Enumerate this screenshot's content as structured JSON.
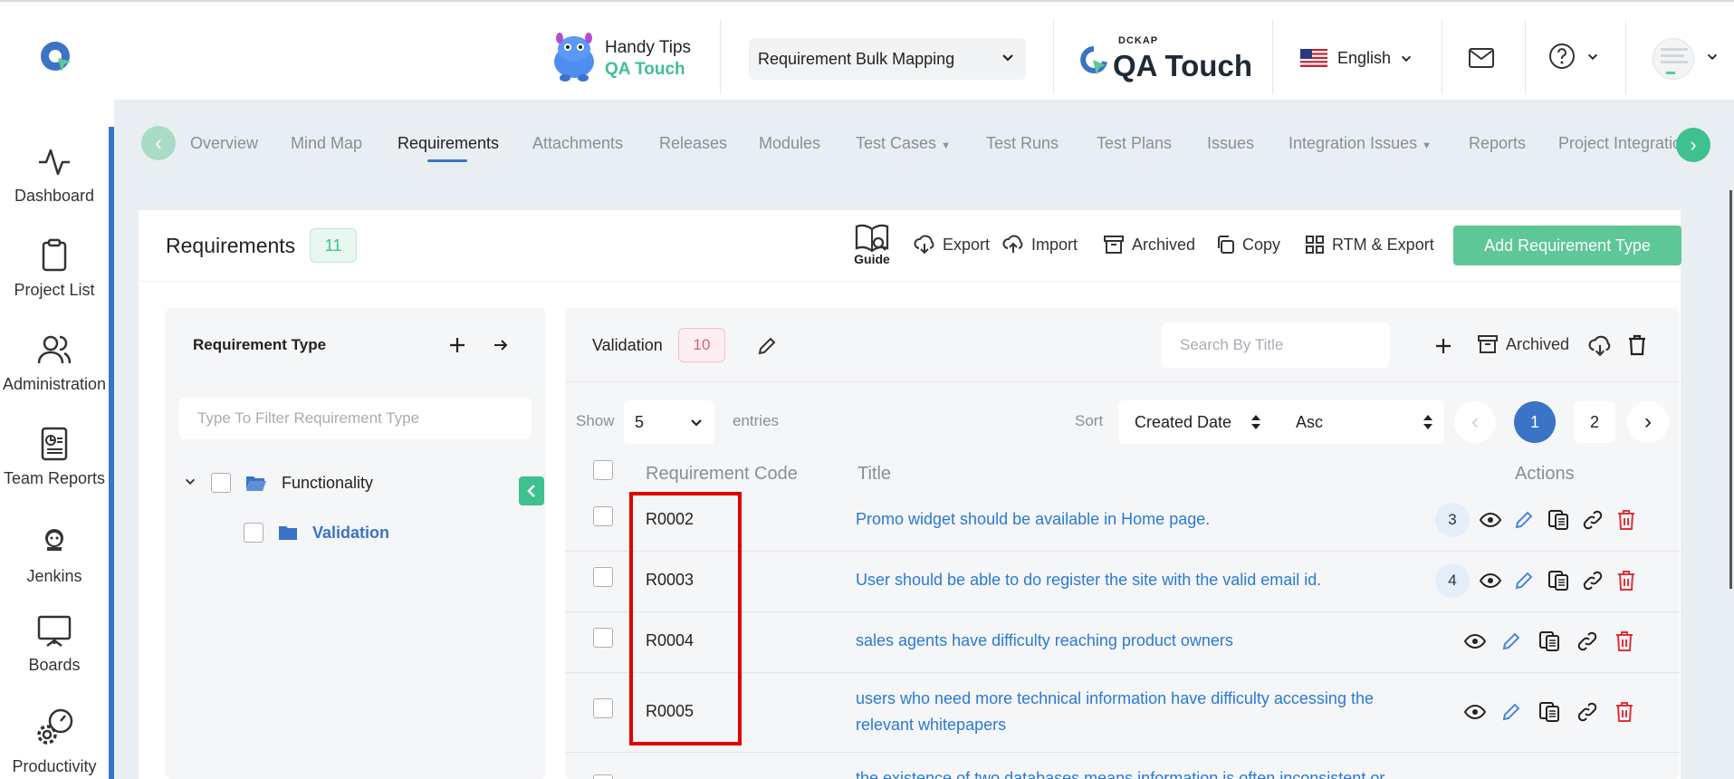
{
  "header": {
    "handy_tips_title": "Handy Tips",
    "handy_tips_subtitle": "QA Touch",
    "project_select": "Requirement Bulk Mapping",
    "brand_small": "DCKAP",
    "brand_name": "QA Touch",
    "language": "English"
  },
  "sidebar": {
    "items": [
      {
        "label": "Dashboard",
        "icon": "activity-icon"
      },
      {
        "label": "Project List",
        "icon": "clipboard-icon"
      },
      {
        "label": "Administration",
        "icon": "users-icon"
      },
      {
        "label": "Team Reports",
        "icon": "report-icon"
      },
      {
        "label": "Jenkins",
        "icon": "jenkins-icon"
      },
      {
        "label": "Boards",
        "icon": "board-icon"
      },
      {
        "label": "Productivity",
        "icon": "gear-gauge-icon"
      }
    ]
  },
  "tabs": [
    {
      "label": "Overview"
    },
    {
      "label": "Mind Map"
    },
    {
      "label": "Requirements"
    },
    {
      "label": "Attachments"
    },
    {
      "label": "Releases"
    },
    {
      "label": "Modules"
    },
    {
      "label": "Test Cases"
    },
    {
      "label": "Test Runs"
    },
    {
      "label": "Test Plans"
    },
    {
      "label": "Issues"
    },
    {
      "label": "Integration Issues"
    },
    {
      "label": "Reports"
    },
    {
      "label": "Project Integratio"
    }
  ],
  "page": {
    "title": "Requirements",
    "count": "11",
    "guide": "Guide",
    "export": "Export",
    "import": "Import",
    "archived": "Archived",
    "copy": "Copy",
    "rtm_export": "RTM & Export",
    "add_button": "Add Requirement Type"
  },
  "left_panel": {
    "title": "Requirement Type",
    "filter_placeholder": "Type To Filter Requirement Type",
    "tree": [
      {
        "label": "Functionality"
      },
      {
        "label": "Validation"
      }
    ]
  },
  "right_panel": {
    "title": "Validation",
    "count": "10",
    "search_placeholder": "Search By Title",
    "archived": "Archived",
    "show_label": "Show",
    "show_value": "5",
    "entries_label": "entries",
    "sort_label": "Sort",
    "sort_field": "Created Date",
    "sort_order": "Asc",
    "pagination": [
      "1",
      "2"
    ],
    "columns": {
      "code": "Requirement Code",
      "title": "Title",
      "actions": "Actions"
    },
    "rows": [
      {
        "code": "R0002",
        "title": "Promo widget should be available in Home page.",
        "count": "3"
      },
      {
        "code": "R0003",
        "title": "User should be able to do register the site with the valid email id.",
        "count": "4"
      },
      {
        "code": "R0004",
        "title": "sales agents have difficulty reaching product owners",
        "count": ""
      },
      {
        "code": "R0005",
        "title_line1": "users who need more technical information have difficulty accessing the",
        "title_line2": "relevant whitepapers",
        "count": ""
      },
      {
        "code": "",
        "title": "the existence of two databases means information is often inconsistent or",
        "count": ""
      }
    ]
  },
  "colors": {
    "accent": "#3b73c6",
    "green": "#5ec797",
    "link": "#2a7ad6",
    "danger": "#e0303a",
    "highlight": "#e00000"
  }
}
